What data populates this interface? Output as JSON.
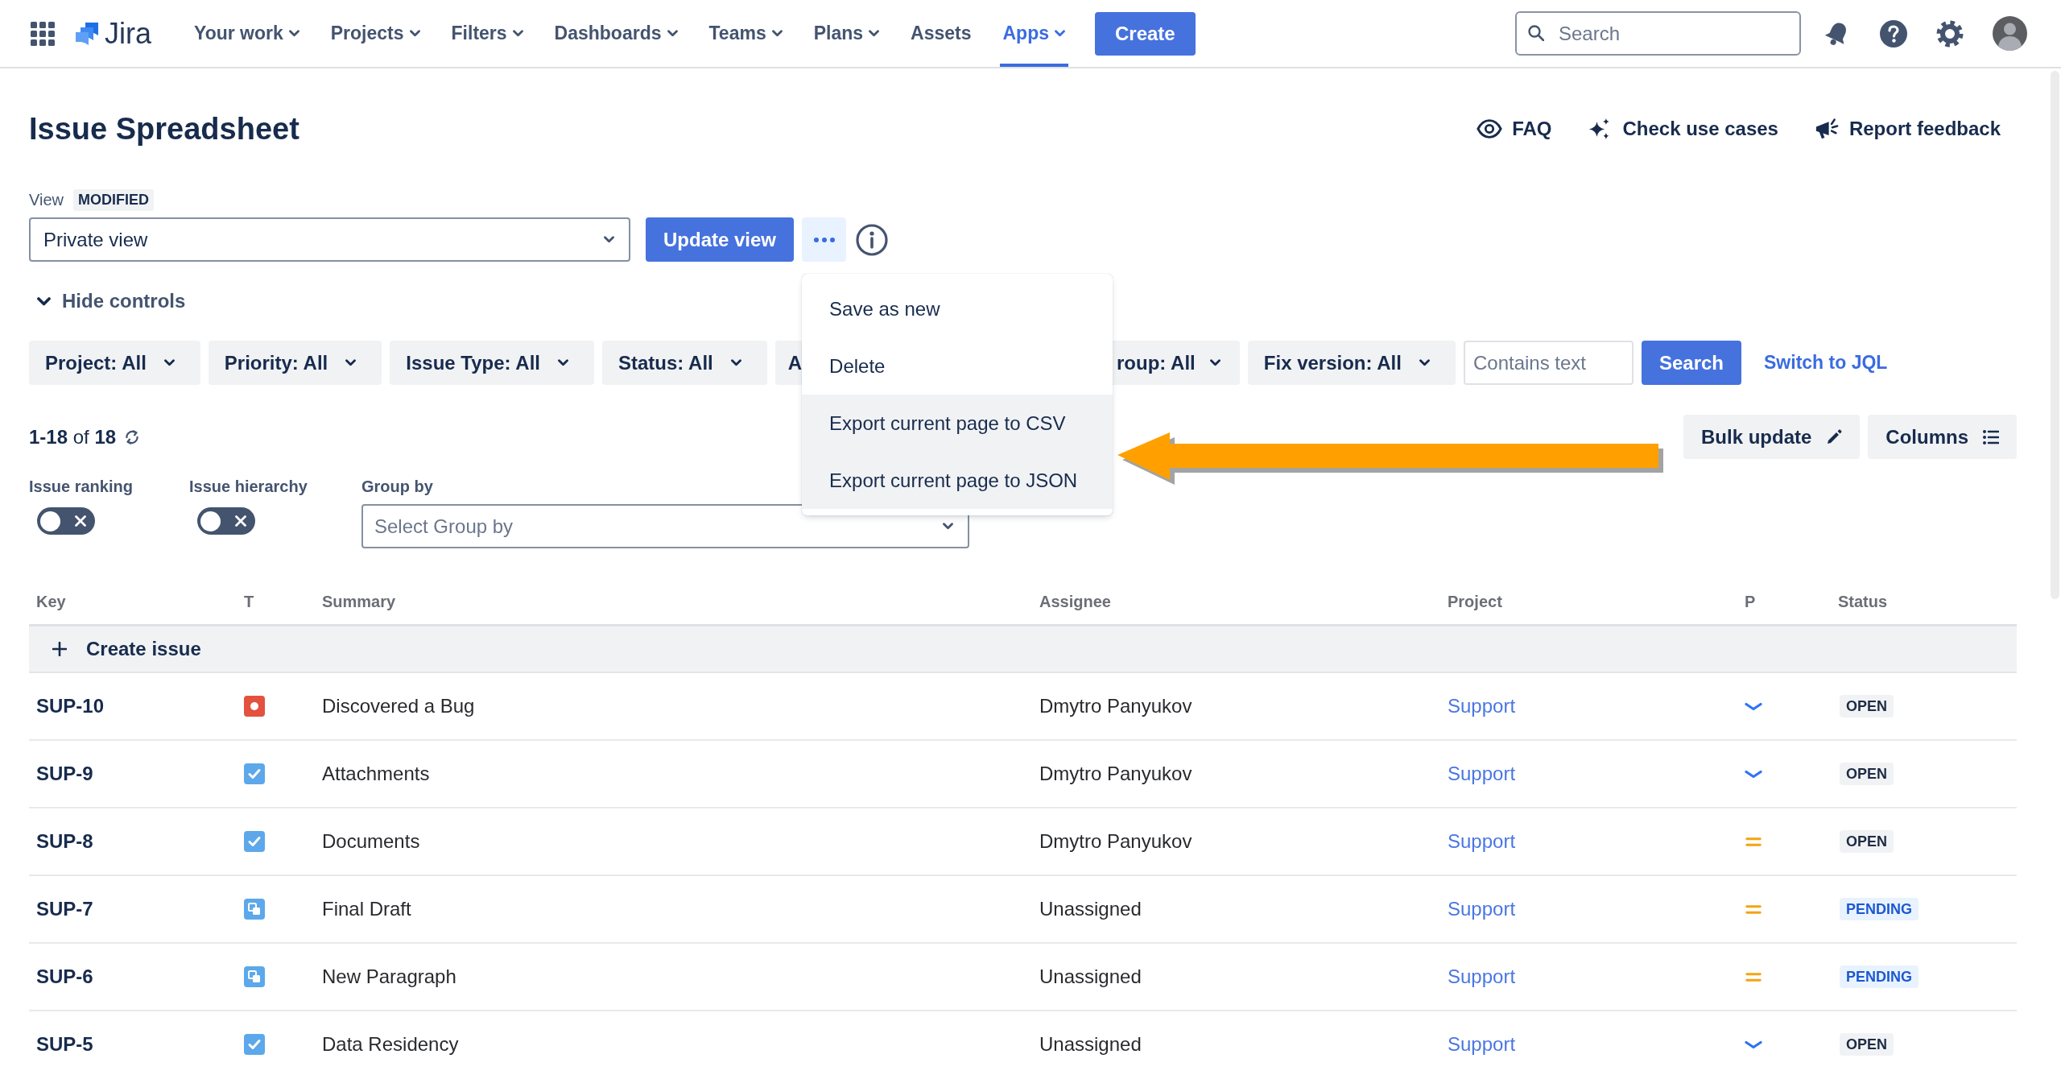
{
  "nav": {
    "logo": "Jira",
    "items": [
      {
        "label": "Your work",
        "dropdown": true,
        "selected": false
      },
      {
        "label": "Projects",
        "dropdown": true,
        "selected": false
      },
      {
        "label": "Filters",
        "dropdown": true,
        "selected": false
      },
      {
        "label": "Dashboards",
        "dropdown": true,
        "selected": false
      },
      {
        "label": "Teams",
        "dropdown": true,
        "selected": false
      },
      {
        "label": "Plans",
        "dropdown": true,
        "selected": false
      },
      {
        "label": "Assets",
        "dropdown": false,
        "selected": false
      },
      {
        "label": "Apps",
        "dropdown": true,
        "selected": true
      }
    ],
    "create_button": "Create",
    "search": {
      "placeholder": "Search"
    }
  },
  "page": {
    "title": "Issue Spreadsheet",
    "actions": [
      {
        "label": "FAQ",
        "kind": "eye"
      },
      {
        "label": "Check use cases",
        "kind": "sparkles"
      },
      {
        "label": "Report feedback",
        "kind": "megaphone"
      }
    ]
  },
  "view": {
    "label": "View",
    "badge": "MODIFIED",
    "value": "Private view",
    "update_button": "Update view",
    "more_menu": {
      "expanded": true,
      "items": [
        {
          "label": "Save as new",
          "highlighted": false
        },
        {
          "label": "Delete",
          "highlighted": false
        },
        {
          "label": "Export current page to CSV",
          "highlighted": true
        },
        {
          "label": "Export current page to JSON",
          "highlighted": true
        }
      ]
    }
  },
  "hide_controls": "Hide controls",
  "filters": [
    {
      "label": "Project: All",
      "kind": "chip"
    },
    {
      "label": "Priority: All",
      "kind": "chip"
    },
    {
      "label": "Issue Type: All",
      "kind": "chip"
    },
    {
      "label": "Status: All",
      "kind": "chip"
    },
    {
      "label": "A",
      "kind": "cut-right"
    },
    {
      "label": "roup: All",
      "kind": "cut-left"
    },
    {
      "label": "Fix version: All",
      "kind": "chip"
    }
  ],
  "text_filter": {
    "placeholder": "Contains text"
  },
  "search_button": "Search",
  "jql_link": "Switch to JQL",
  "count": "**1-18** of **18**",
  "bulk_update": "Bulk update",
  "columns_button": "Columns",
  "toggles": [
    {
      "label": "Issue ranking",
      "on": false
    },
    {
      "label": "Issue hierarchy",
      "on": false
    }
  ],
  "group_by": {
    "label": "Group by",
    "placeholder": "Select Group by"
  },
  "table": {
    "columns": [
      "Key",
      "T",
      "Summary",
      "Assignee",
      "Project",
      "P",
      "Status"
    ],
    "create_row": "Create issue",
    "rows": [
      {
        "key": "SUP-10",
        "issue_type": {
          "kind": "bug"
        },
        "summary": "Discovered a Bug",
        "assignee": "Dmytro Panyukov",
        "project": "Support",
        "priority": {
          "kind": "low"
        },
        "status": {
          "label": "OPEN",
          "kind": "neutral"
        }
      },
      {
        "key": "SUP-9",
        "issue_type": {
          "kind": "task"
        },
        "summary": "Attachments",
        "assignee": "Dmytro Panyukov",
        "project": "Support",
        "priority": {
          "kind": "low"
        },
        "status": {
          "label": "OPEN",
          "kind": "neutral"
        }
      },
      {
        "key": "SUP-8",
        "issue_type": {
          "kind": "task"
        },
        "summary": "Documents",
        "assignee": "Dmytro Panyukov",
        "project": "Support",
        "priority": {
          "kind": "medium"
        },
        "status": {
          "label": "OPEN",
          "kind": "neutral"
        }
      },
      {
        "key": "SUP-7",
        "issue_type": {
          "kind": "subtask"
        },
        "summary": "Final Draft",
        "assignee": "Unassigned",
        "project": "Support",
        "priority": {
          "kind": "medium"
        },
        "status": {
          "label": "PENDING",
          "kind": "info"
        }
      },
      {
        "key": "SUP-6",
        "issue_type": {
          "kind": "subtask"
        },
        "summary": "New Paragraph",
        "assignee": "Unassigned",
        "project": "Support",
        "priority": {
          "kind": "medium"
        },
        "status": {
          "label": "PENDING",
          "kind": "info"
        }
      },
      {
        "key": "SUP-5",
        "issue_type": {
          "kind": "task"
        },
        "summary": "Data Residency",
        "assignee": "Unassigned",
        "project": "Support",
        "priority": {
          "kind": "low"
        },
        "status": {
          "label": "OPEN",
          "kind": "neutral"
        }
      }
    ]
  }
}
